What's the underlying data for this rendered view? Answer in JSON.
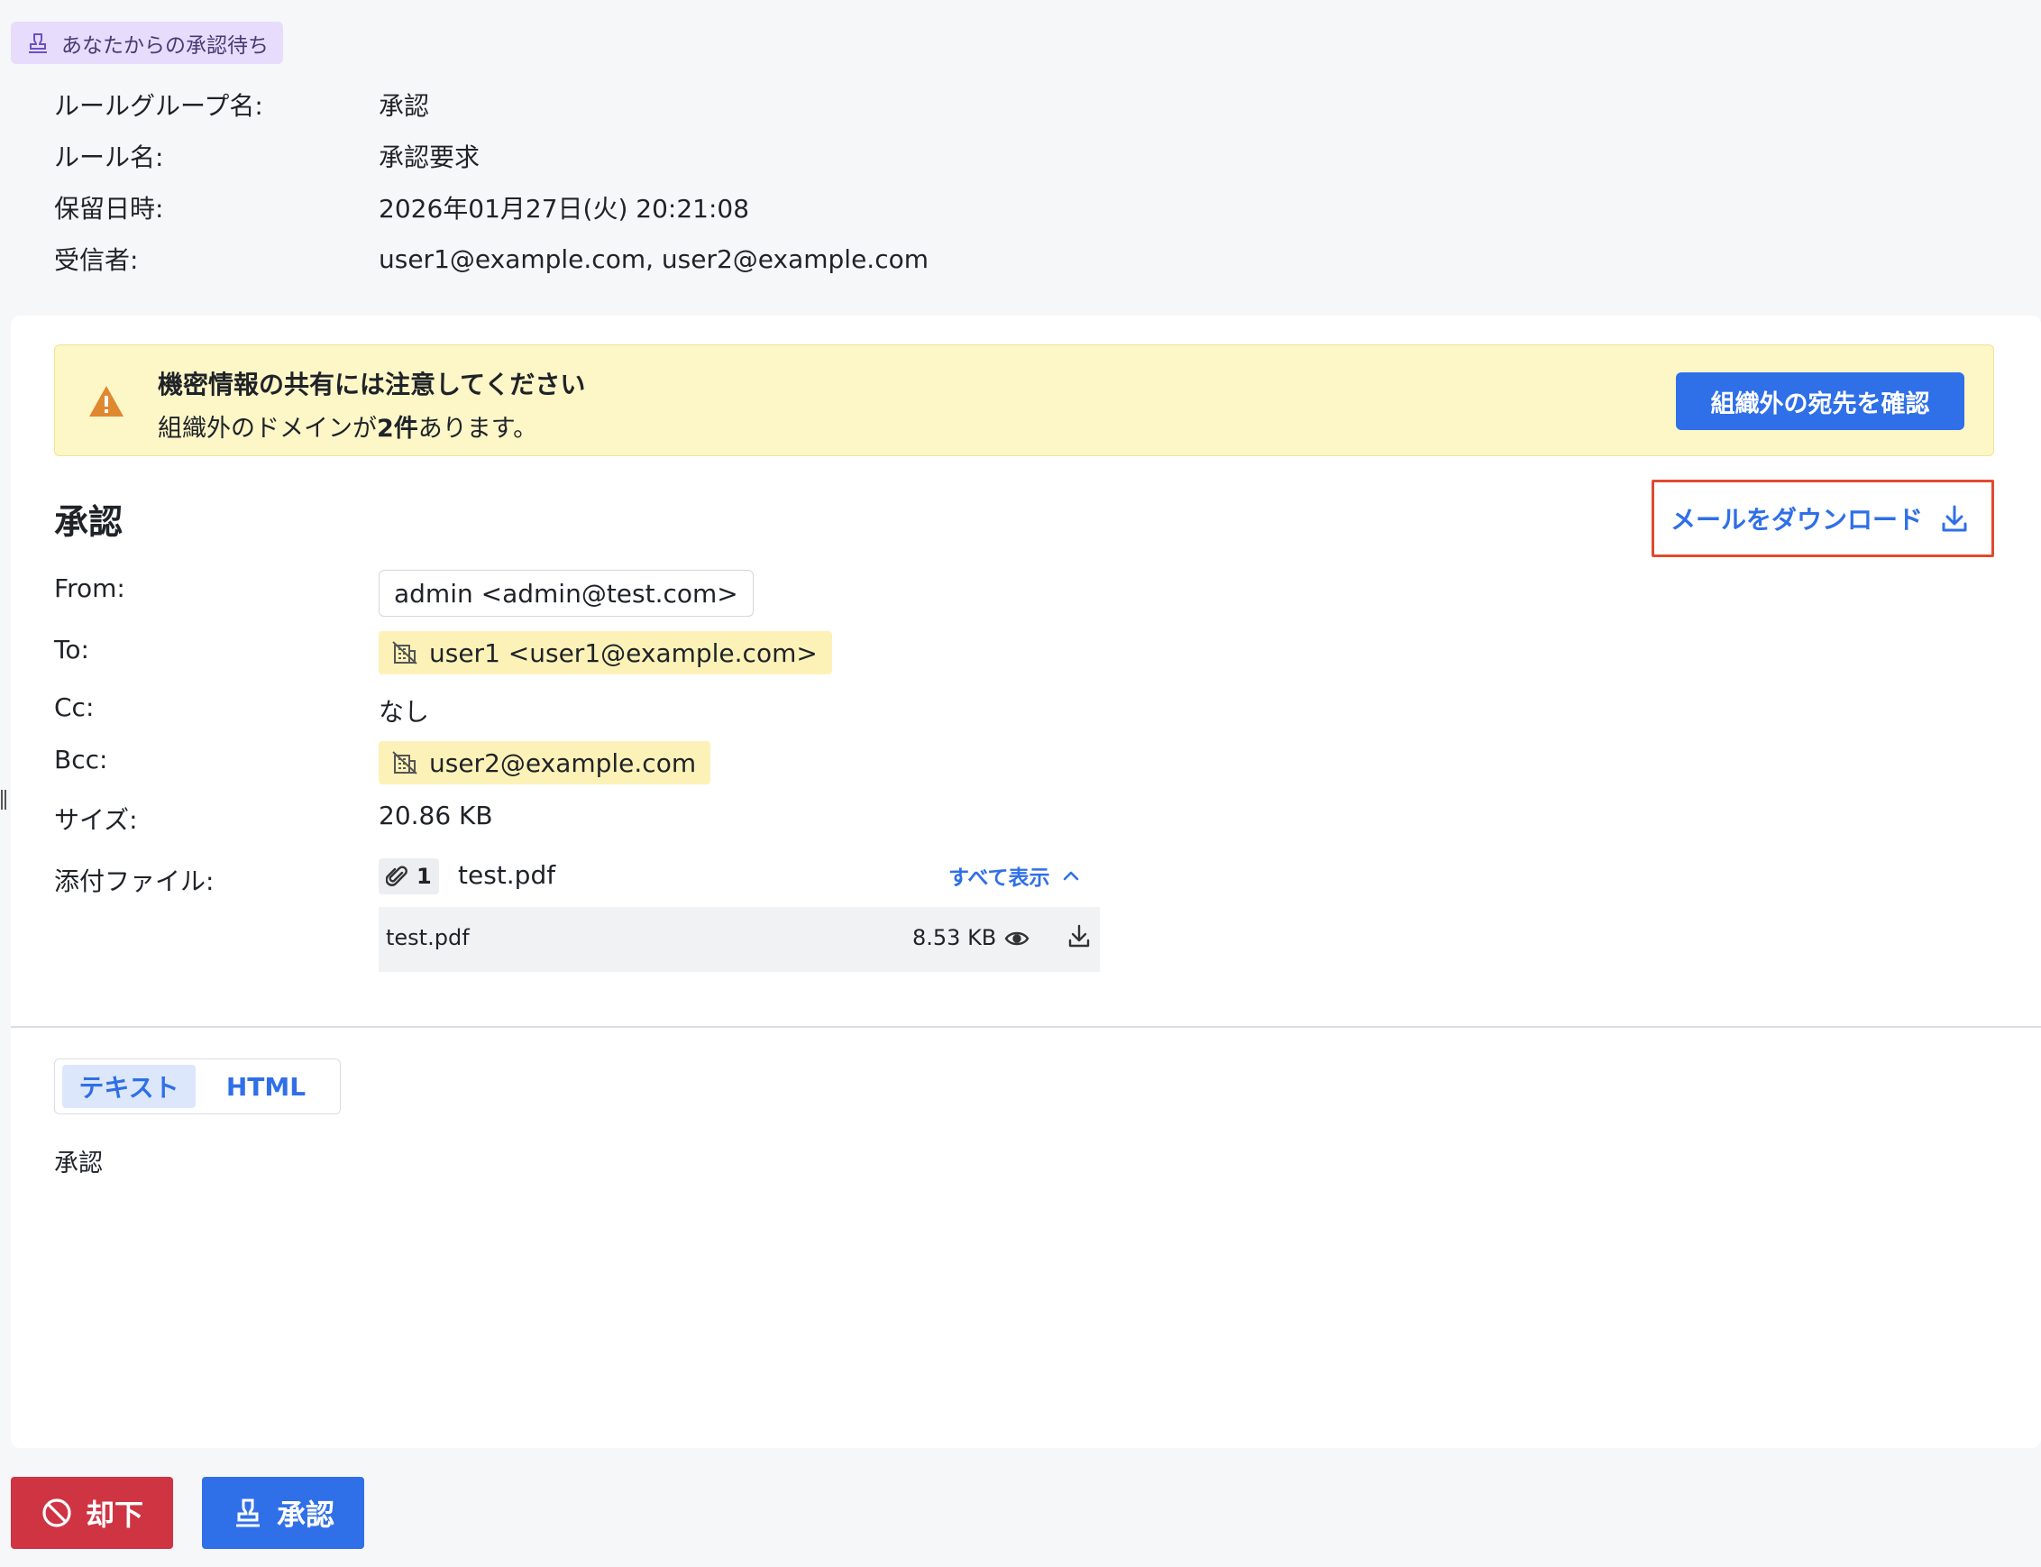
{
  "status_badge": {
    "label": "あなたからの承認待ち",
    "icon": "stamp-icon"
  },
  "meta": {
    "rule_group": {
      "label": "ルールグループ名:",
      "value": "承認"
    },
    "rule_name": {
      "label": "ルール名:",
      "value": "承認要求"
    },
    "held_at": {
      "label": "保留日時:",
      "value": "2026年01月27日(火) 20:21:08"
    },
    "recipients": {
      "label": "受信者:",
      "value": "user1@example.com,  user2@example.com"
    }
  },
  "warning": {
    "title": "機密情報の共有には注意してください",
    "message_prefix": "組織外のドメインが",
    "message_count": "2件",
    "message_suffix": "あります。",
    "button_label": "組織外の宛先を確認",
    "icon": "warning-triangle-icon"
  },
  "mail": {
    "subject": "承認",
    "download_label": "メールをダウンロード",
    "from": {
      "label": "From:",
      "value": "admin <admin@test.com>"
    },
    "to": {
      "label": "To:",
      "value": "user1 <user1@example.com>"
    },
    "cc": {
      "label": "Cc:",
      "value": "なし"
    },
    "bcc": {
      "label": "Bcc:",
      "value": "user2@example.com"
    },
    "size": {
      "label": "サイズ:",
      "value": "20.86 KB"
    },
    "attachments": {
      "label": "添付ファイル:",
      "count": "1",
      "summary_name": "test.pdf",
      "show_all_label": "すべて表示",
      "items": [
        {
          "name": "test.pdf",
          "size": "8.53 KB"
        }
      ]
    }
  },
  "tabs": [
    {
      "label": "テキスト",
      "active": true
    },
    {
      "label": "HTML",
      "active": false
    }
  ],
  "body_text": "承認",
  "actions": {
    "reject_label": "却下",
    "approve_label": "承認"
  },
  "colors": {
    "accent": "#2f6fe8",
    "danger": "#cf3443",
    "warning_bg": "#fdf6c7",
    "external_chip_bg": "#fcf2b8",
    "badge_bg": "#e7dcfb",
    "highlight_border": "#e14a2f"
  }
}
